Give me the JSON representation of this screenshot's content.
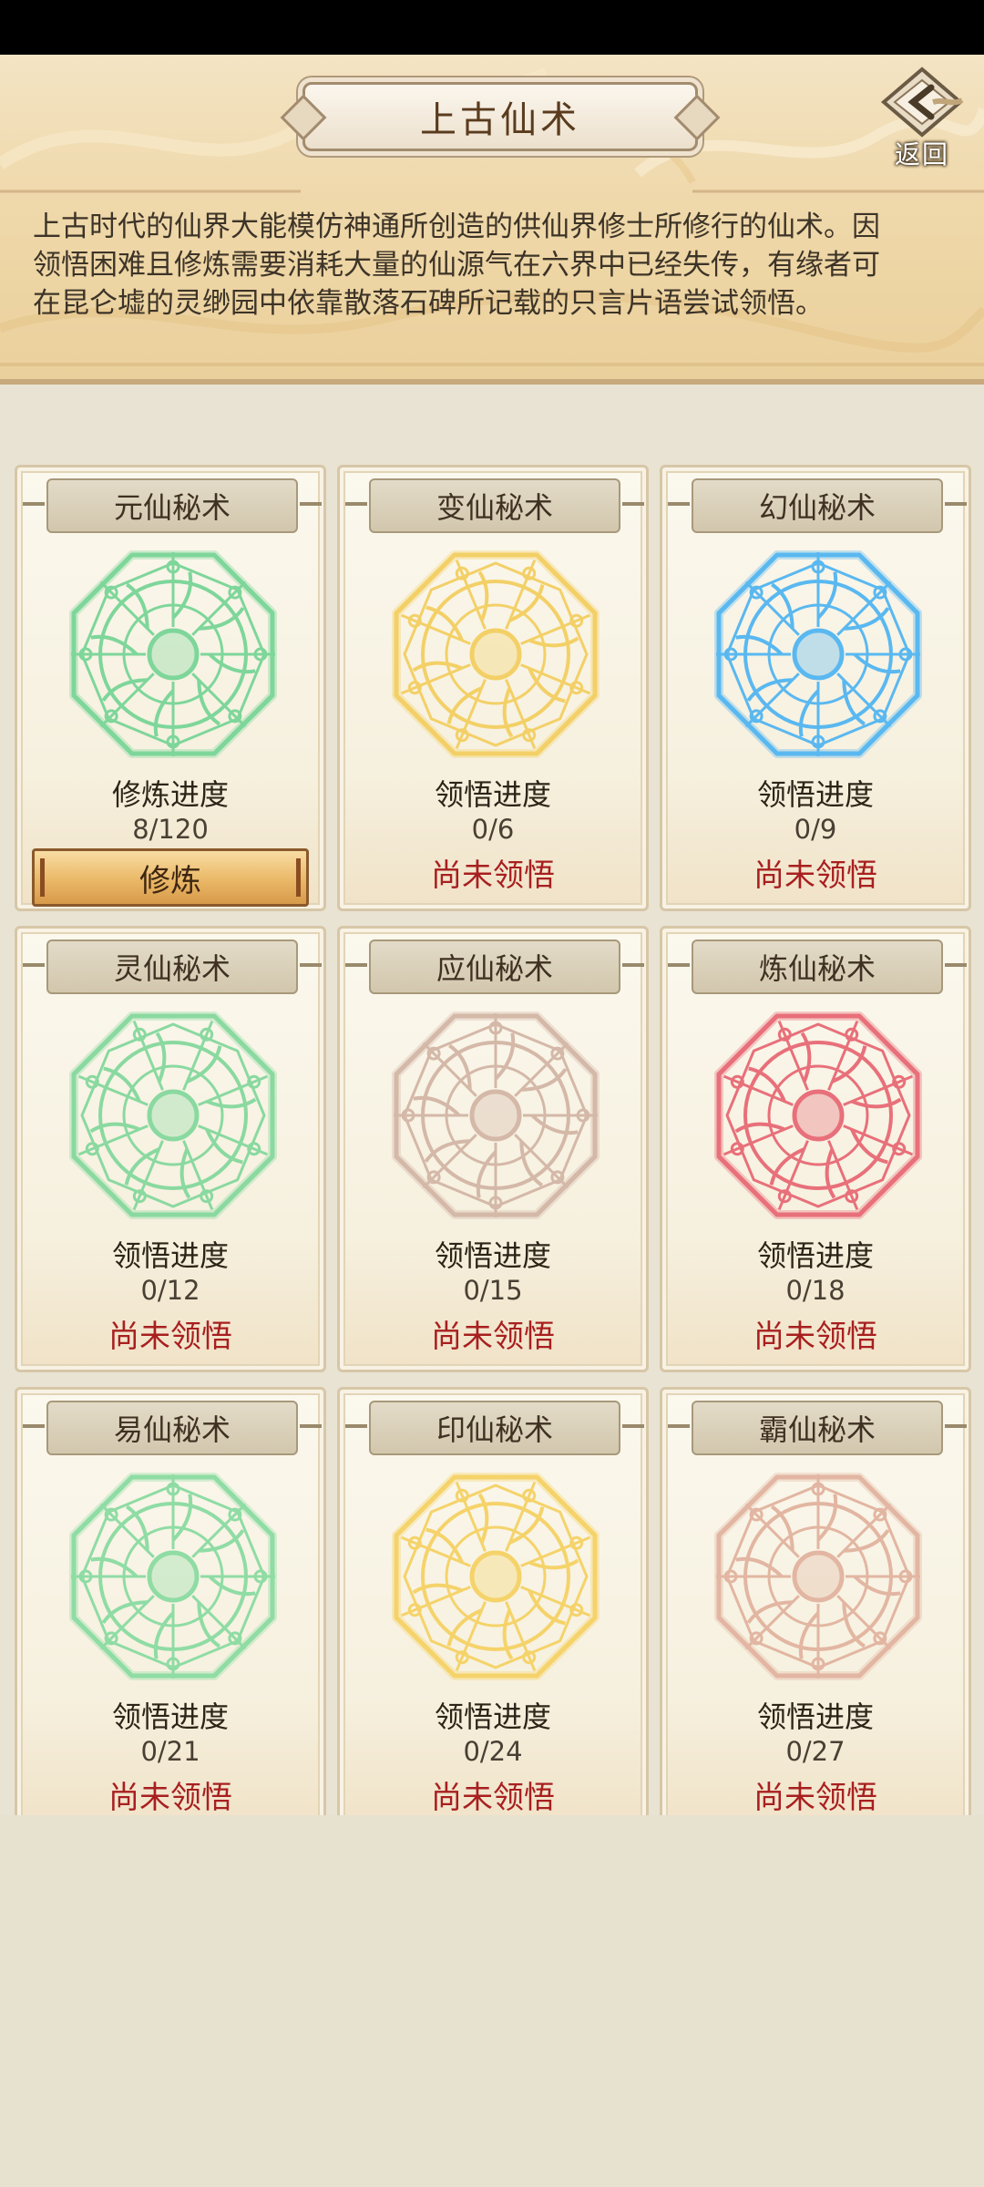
{
  "header": {
    "title": "上古仙术",
    "back_label": "返回",
    "description_lines": [
      "上古时代的仙界大能模仿神通所创造的供仙界修士所修行的仙术。因",
      "领悟困难且修炼需要消耗大量的仙源气在六界中已经失传，有缘者可",
      "在昆仑墟的灵缈园中依靠散落石碑所记载的只言片语尝试领悟。"
    ]
  },
  "cards": [
    {
      "name": "元仙秘术",
      "progress_label": "修炼进度",
      "progress": "8/120",
      "action": "修炼",
      "glyph_color": "#7ed69a",
      "glyph_icon": "yin-yang-icon"
    },
    {
      "name": "变仙秘术",
      "progress_label": "领悟进度",
      "progress": "0/6",
      "status": "尚未领悟",
      "glyph_color": "#f3d067",
      "glyph_icon": "eye-icon"
    },
    {
      "name": "幻仙秘术",
      "progress_label": "领悟进度",
      "progress": "0/9",
      "status": "尚未领悟",
      "glyph_color": "#5ab8f0",
      "glyph_icon": "spiral-icon"
    },
    {
      "name": "灵仙秘术",
      "progress_label": "领悟进度",
      "progress": "0/12",
      "status": "尚未领悟",
      "glyph_color": "#8ad9a0",
      "glyph_icon": "flower-icon"
    },
    {
      "name": "应仙秘术",
      "progress_label": "领悟进度",
      "progress": "0/15",
      "status": "尚未领悟",
      "glyph_color": "#d4b8a8",
      "glyph_icon": "knot-icon"
    },
    {
      "name": "炼仙秘术",
      "progress_label": "领悟进度",
      "progress": "0/18",
      "status": "尚未领悟",
      "glyph_color": "#e8707a",
      "glyph_icon": "triskelion-icon"
    },
    {
      "name": "易仙秘术",
      "progress_label": "领悟进度",
      "progress": "0/21",
      "status": "尚未领悟",
      "glyph_color": "#8fdca4",
      "glyph_icon": "star-icon"
    },
    {
      "name": "印仙秘术",
      "progress_label": "领悟进度",
      "progress": "0/24",
      "status": "尚未领悟",
      "glyph_color": "#f5d36a",
      "glyph_icon": "flame-icon"
    },
    {
      "name": "霸仙秘术",
      "progress_label": "领悟进度",
      "progress": "0/27",
      "status": "尚未领悟",
      "glyph_color": "#e2b6a2",
      "glyph_icon": "lattice-icon"
    }
  ]
}
